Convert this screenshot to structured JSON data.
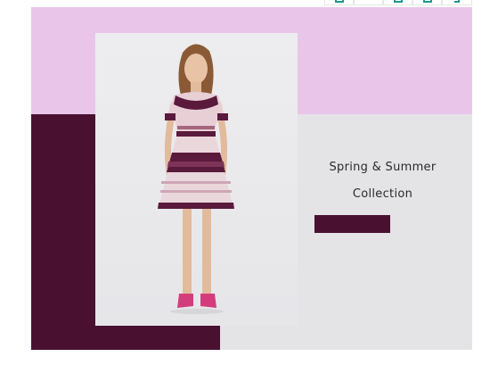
{
  "toolbar": {
    "buttons": [
      {
        "icon": "bookmark-icon"
      },
      {
        "icon": "blank"
      },
      {
        "icon": "bookmark-icon"
      },
      {
        "icon": "bookmark-icon"
      },
      {
        "icon": "search-icon"
      }
    ],
    "accent": "#1a9a8c"
  },
  "banner": {
    "title_line1": "Spring & Summer",
    "title_line2": "Collection",
    "button_label": "",
    "colors": {
      "pink": "#e9c6e9",
      "plum": "#4a1030",
      "grey": "#e4e3e6"
    }
  }
}
